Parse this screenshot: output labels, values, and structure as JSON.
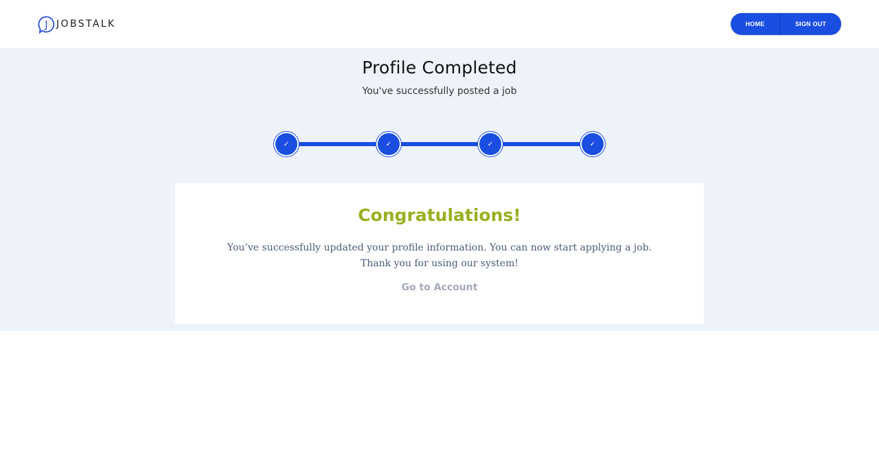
{
  "header": {
    "logo_text": "JOBSTALK",
    "logo_letter": "J",
    "nav": {
      "home_label": "HOME",
      "signout_label": "SIGN OUT"
    }
  },
  "page": {
    "title": "Profile Completed",
    "subtitle": "You've successfully posted a job"
  },
  "stepper": {
    "steps": [
      {
        "status": "completed",
        "icon": "check-icon",
        "glyph": "✓"
      },
      {
        "status": "completed",
        "icon": "check-icon",
        "glyph": "✓"
      },
      {
        "status": "completed",
        "icon": "check-icon",
        "glyph": "✓"
      },
      {
        "status": "completed",
        "icon": "check-icon",
        "glyph": "✓"
      }
    ]
  },
  "card": {
    "heading": "Congratulations!",
    "message_line1": "You’ve successfully updated your profile information. You can now start applying a job.",
    "message_line2": "Thank you for using our system!",
    "link_label": "Go to Account"
  },
  "colors": {
    "primary": "#1a4ee0",
    "success_heading": "#9ab023",
    "band_background": "#eef2f9",
    "link_muted": "#a3a9b8"
  }
}
